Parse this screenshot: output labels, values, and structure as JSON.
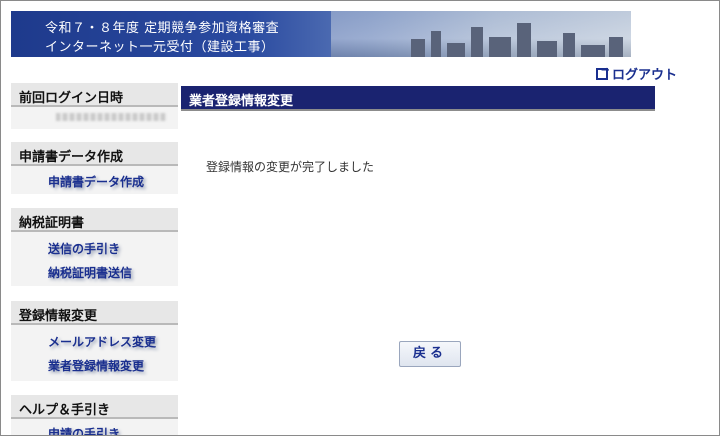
{
  "header": {
    "title_line1": "令和７・８年度 定期競争参加資格審査",
    "title_line2": "インターネット一元受付（建設工事）"
  },
  "logout": {
    "label": "ログアウト",
    "icon": "logout-icon"
  },
  "sidebar": {
    "last_login": {
      "heading": "前回ログイン日時"
    },
    "sections": [
      {
        "heading": "申請書データ作成",
        "items": [
          "申請書データ作成"
        ]
      },
      {
        "heading": "納税証明書",
        "items": [
          "送信の手引き",
          "納税証明書送信"
        ]
      },
      {
        "heading": "登録情報変更",
        "items": [
          "メールアドレス変更",
          "業者登録情報変更"
        ]
      },
      {
        "heading": "ヘルプ＆手引き",
        "items": [
          "申請の手引き"
        ]
      }
    ]
  },
  "main": {
    "title": "業者登録情報変更",
    "message": "登録情報の変更が完了しました",
    "back_button": "戻る"
  }
}
